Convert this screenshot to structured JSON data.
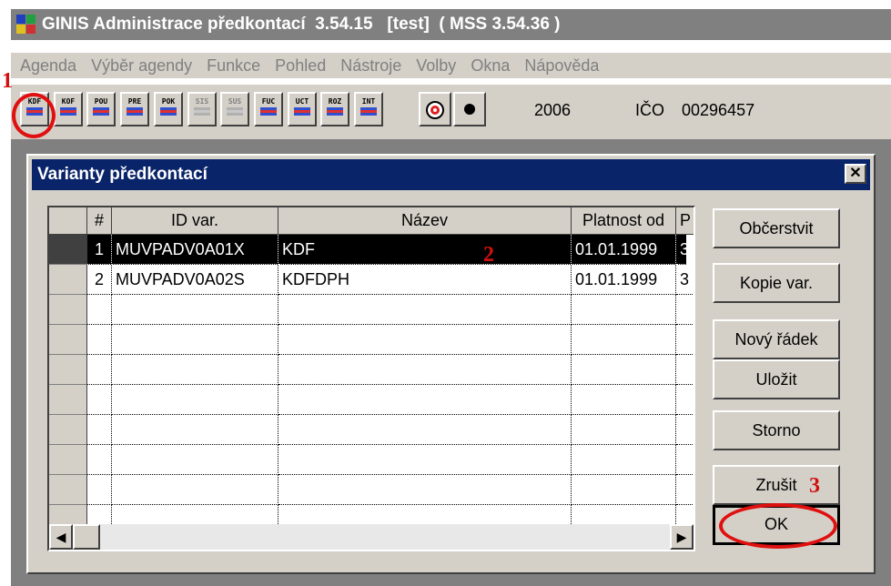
{
  "window": {
    "title": "GINIS Administrace předkontací  3.54.15   [test]  ( MSS 3.54.36 )"
  },
  "menu": [
    "Agenda",
    "Výběr agendy",
    "Funkce",
    "Pohled",
    "Nástroje",
    "Volby",
    "Okna",
    "Nápověda"
  ],
  "toolbar": {
    "buttons": [
      {
        "label": "KDF",
        "disabled": false
      },
      {
        "label": "KOF",
        "disabled": false
      },
      {
        "label": "POU",
        "disabled": false
      },
      {
        "label": "PRE",
        "disabled": false
      },
      {
        "label": "POK",
        "disabled": false
      },
      {
        "label": "SIS",
        "disabled": true
      },
      {
        "label": "SUS",
        "disabled": true
      },
      {
        "label": "FUC",
        "disabled": false
      },
      {
        "label": "UCT",
        "disabled": false
      },
      {
        "label": "ROZ",
        "disabled": false
      },
      {
        "label": "INT",
        "disabled": false
      }
    ],
    "year": "2006",
    "ico_label": "IČO",
    "ico_value": "00296457"
  },
  "dialog": {
    "title": "Varianty předkontací",
    "close_label": "✕",
    "columns": [
      "#",
      "ID var.",
      "Název",
      "Platnost od",
      "P"
    ],
    "rows": [
      {
        "num": "1",
        "id": "MUVPADV0A01X",
        "name": "KDF",
        "valid_from": "01.01.1999",
        "p": "3",
        "selected": true
      },
      {
        "num": "2",
        "id": "MUVPADV0A02S",
        "name": "KDFDPH",
        "valid_from": "01.01.1999",
        "p": "3",
        "selected": false
      }
    ],
    "buttons": {
      "refresh": "Občerstvit",
      "copy": "Kopie var.",
      "new_row": "Nový řádek",
      "save": "Uložit",
      "cancel": "Storno",
      "delete": "Zrušit",
      "ok": "OK"
    }
  },
  "annotations": [
    "1",
    "2",
    "3"
  ]
}
